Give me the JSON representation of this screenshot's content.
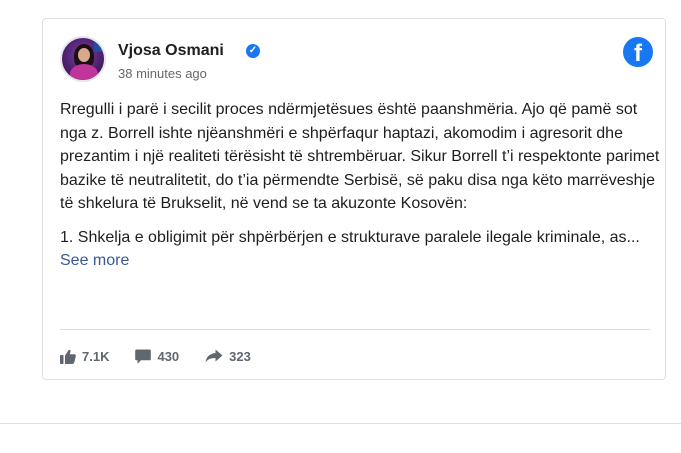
{
  "post": {
    "author": "Vjosa Osmani",
    "time": "38 minutes ago",
    "paragraphs": [
      "Rregulli i parë i secilit proces ndërmjetësues është paanshmëria. Ajo që pamë sot nga z. Borrell ishte njëanshmëri e shpërfaqur haptazi, akomodim i agresorit dhe prezantim i një realiteti tërësisht të shtrembëruar. Sikur Borrell t’i respektonte parimet bazike të neutralitetit, do t’ia përmendte Serbisë, së paku disa nga këto marrëveshje të shkelura të Brukselit, në vend se ta akuzonte Kosovën:",
      "1. Shkelja e obligimit për shpërbërjen e strukturave paralele ilegale kriminale, as..."
    ],
    "see_more": "See more"
  },
  "stats": {
    "likes": "7.1K",
    "comments": "430",
    "shares": "323"
  },
  "icons": {
    "verified": "verified-check-icon",
    "logo": "facebook-logo-icon",
    "like": "thumbs-up-icon",
    "comment": "comment-icon",
    "share": "share-arrow-icon"
  },
  "colors": {
    "brand": "#1877f2",
    "link": "#385898",
    "muted": "#65676b"
  }
}
